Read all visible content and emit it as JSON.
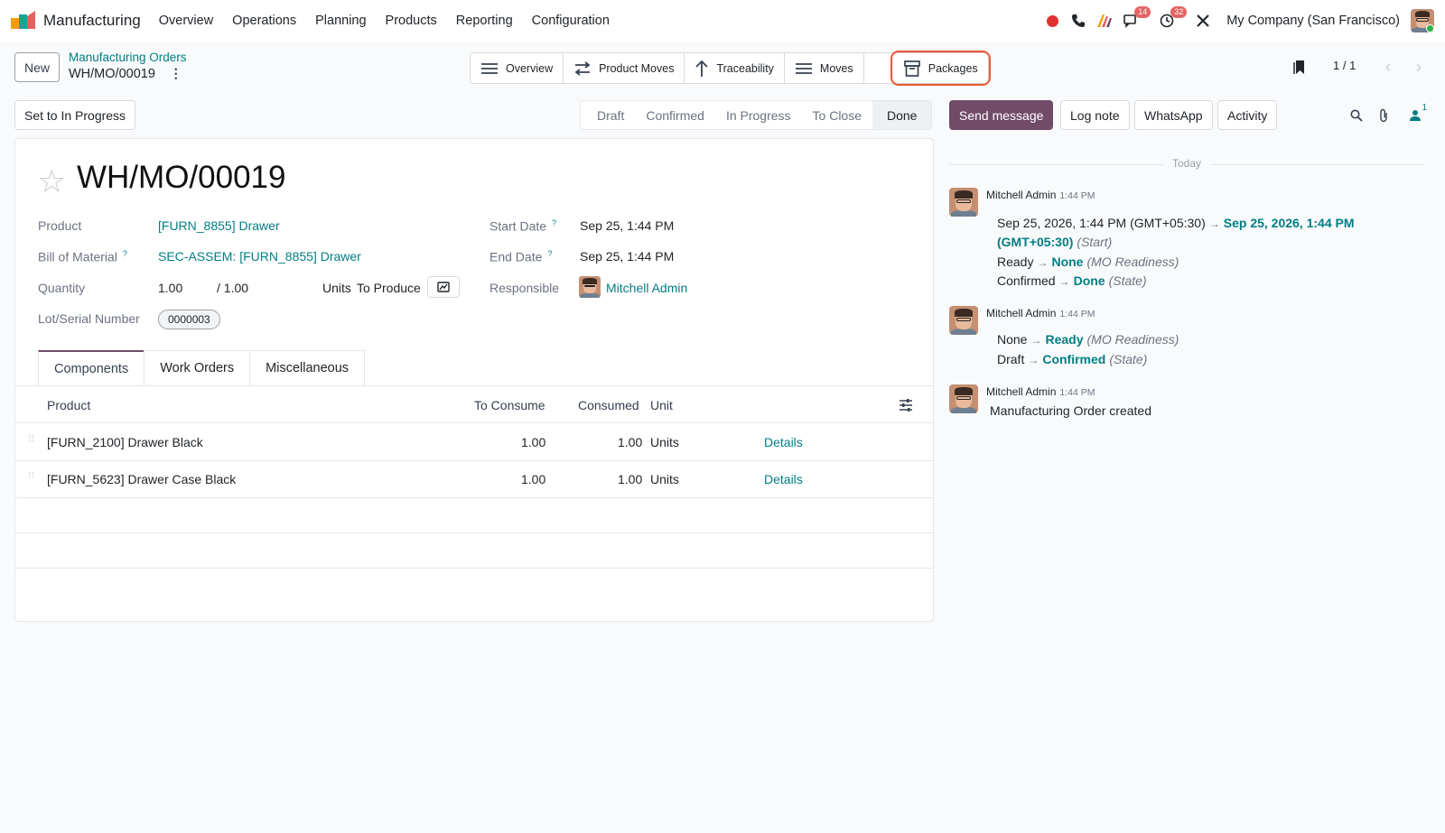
{
  "nav": {
    "app_name": "Manufacturing",
    "menu": [
      "Overview",
      "Operations",
      "Planning",
      "Products",
      "Reporting",
      "Configuration"
    ],
    "chat_badge": "14",
    "activity_badge": "32",
    "company": "My Company (San Francisco)"
  },
  "control": {
    "new_label": "New",
    "breadcrumb_parent": "Manufacturing Orders",
    "breadcrumb_current": "WH/MO/00019",
    "smart_buttons": [
      "Overview",
      "Product Moves",
      "Traceability",
      "Moves",
      "Packages"
    ],
    "pager": "1 / 1"
  },
  "status": {
    "action_label": "Set to In Progress",
    "steps": [
      "Draft",
      "Confirmed",
      "In Progress",
      "To Close",
      "Done"
    ],
    "active": "Done"
  },
  "form": {
    "title": "WH/MO/00019",
    "product_label": "Product",
    "product_value": "[FURN_8855] Drawer",
    "bom_label": "Bill of Material",
    "bom_value": "SEC-ASSEM: [FURN_8855] Drawer",
    "quantity_label": "Quantity",
    "quantity_value": "1.00",
    "quantity_total": "/ 1.00",
    "quantity_unit": "Units",
    "to_produce": "To Produce",
    "lot_label": "Lot/Serial Number",
    "lot_value": "0000003",
    "start_label": "Start Date",
    "start_value": "Sep 25, 1:44 PM",
    "end_label": "End Date",
    "end_value": "Sep 25, 1:44 PM",
    "responsible_label": "Responsible",
    "responsible_value": "Mitchell Admin",
    "help_mark": "?"
  },
  "tabs": [
    "Components",
    "Work Orders",
    "Miscellaneous"
  ],
  "components": {
    "headers": {
      "product": "Product",
      "to_consume": "To Consume",
      "consumed": "Consumed",
      "unit": "Unit"
    },
    "rows": [
      {
        "product": "[FURN_2100] Drawer Black",
        "to_consume": "1.00",
        "consumed": "1.00",
        "unit": "Units",
        "action": "Details"
      },
      {
        "product": "[FURN_5623] Drawer Case Black",
        "to_consume": "1.00",
        "consumed": "1.00",
        "unit": "Units",
        "action": "Details"
      }
    ]
  },
  "chatter": {
    "send_message": "Send message",
    "log_note": "Log note",
    "whatsapp": "WhatsApp",
    "activity": "Activity",
    "followers_count": "1",
    "today": "Today",
    "messages": [
      {
        "author": "Mitchell Admin",
        "time": "1:44 PM",
        "changes": [
          {
            "old": "Sep 25, 2026, 1:44 PM (GMT+05:30)",
            "new": "Sep 25, 2026, 1:44 PM",
            "new_cont": "(GMT+05:30)",
            "field": "(Start)"
          },
          {
            "old": "Ready",
            "new": "None",
            "field": "(MO Readiness)"
          },
          {
            "old": "Confirmed",
            "new": "Done",
            "field": "(State)"
          }
        ]
      },
      {
        "author": "Mitchell Admin",
        "time": "1:44 PM",
        "changes": [
          {
            "old": "None",
            "new": "Ready",
            "field": "(MO Readiness)"
          },
          {
            "old": "Draft",
            "new": "Confirmed",
            "field": "(State)"
          }
        ]
      },
      {
        "author": "Mitchell Admin",
        "time": "1:44 PM",
        "body": "Manufacturing Order created"
      }
    ]
  },
  "colors": {
    "primary": "#714b67",
    "link": "#017e84",
    "highlight": "#e85d3b"
  }
}
